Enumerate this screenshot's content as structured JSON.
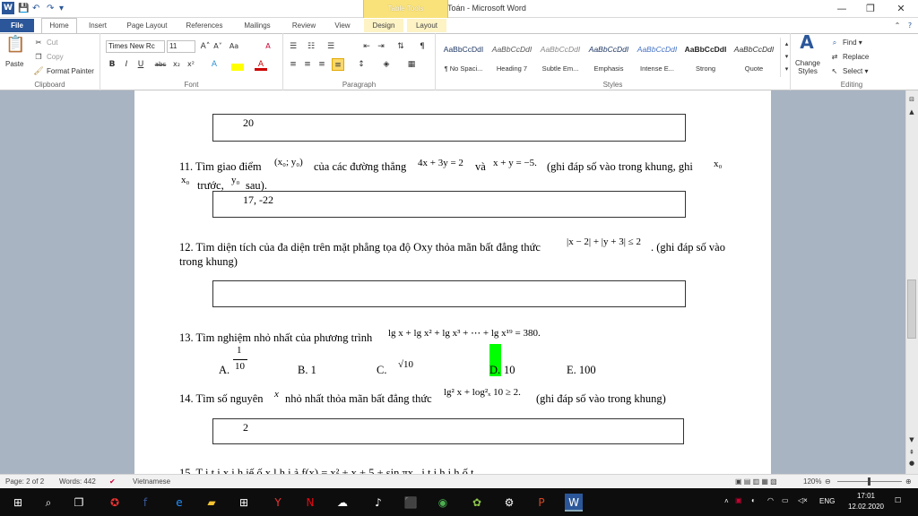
{
  "window": {
    "title": "Đề thi thứ môn Toán - Microsoft Word",
    "context_tab_group": "Table Tools"
  },
  "quick_access": {
    "word": "W",
    "save": "💾",
    "undo": "↶",
    "redo": "↷",
    "more": "▾"
  },
  "window_controls": {
    "minimize": "—",
    "restore": "❐",
    "close": "✕"
  },
  "tabs": [
    "File",
    "Home",
    "Insert",
    "Page Layout",
    "References",
    "Mailings",
    "Review",
    "View",
    "Design",
    "Layout"
  ],
  "clipboard": {
    "paste": "Paste",
    "cut": "Cut",
    "copy": "Copy",
    "format_painter": "Format Painter",
    "label": "Clipboard"
  },
  "font": {
    "name": "Times New Rc",
    "size": "11",
    "label": "Font",
    "bold": "B",
    "italic": "I",
    "underline": "U",
    "strike": "abc",
    "sub": "x₂",
    "sup": "x²",
    "grow": "A˄",
    "shrink": "A˅",
    "case": "Aa",
    "clear": "A"
  },
  "paragraph": {
    "label": "Paragraph"
  },
  "styles": {
    "label": "Styles",
    "items": [
      {
        "sample": "AaBbCcDdI",
        "name": "¶ No Spaci..."
      },
      {
        "sample": "AaBbCcDdI",
        "name": "Heading 7"
      },
      {
        "sample": "AaBbCcDdI",
        "name": "Subtle Em..."
      },
      {
        "sample": "AaBbCcDdI",
        "name": "Emphasis"
      },
      {
        "sample": "AaBbCcDdI",
        "name": "Intense E..."
      },
      {
        "sample": "AaBbCcDdI",
        "name": "Strong"
      },
      {
        "sample": "AaBbCcDdI",
        "name": "Quote"
      }
    ],
    "change": "Change Styles"
  },
  "editing": {
    "find": "Find ▾",
    "replace": "Replace",
    "select": "Select ▾",
    "label": "Editing"
  },
  "document": {
    "box1": "20",
    "q11_line1": "11. Tìm giao điểm",
    "q11_pt": "(x₀; y₀)",
    "q11_mid": "của các đường thẳng",
    "q11_eq1": "4x + 3y = 2",
    "q11_and": "và",
    "q11_eq2": "x + y = −5.",
    "q11_tail": "(ghi đáp số vào trong khung,  ghi",
    "q11_x0": "x₀",
    "q11_x0b": "x₀",
    "q11_line2a": "trước,",
    "q11_y0": "y₀",
    "q11_line2b": "sau).",
    "box2": "17, -22",
    "q12_line1": "12. Tìm diện tích của đa diện trên mặt phẳng tọa độ Oxy  thỏa mãn bất đẳng thức",
    "q12_ineq": "|x − 2| + |y + 3| ≤ 2",
    "q12_tail": ". (ghi đáp số vào",
    "q12_line2": "trong khung)",
    "box3": "",
    "q13": "13. Tìm nghiệm nhỏ nhất của phương trình",
    "q13_eq": "lg x + lg x² + lg x³ + ⋯ + lg x¹⁹ = 380.",
    "q13_a_label": "A.",
    "q13_a_num": "1",
    "q13_a_den": "10",
    "q13_b": "B.  1",
    "q13_c": "C.",
    "q13_c_val": "√10",
    "q13_d": "D.",
    "q13_d_val": "10",
    "q13_e": "E.  100",
    "q14": "14. Tìm số nguyên",
    "q14_x": "x",
    "q14_mid": "nhỏ nhất thỏa mãn bất đẳng thức",
    "q14_ineq": "lg² x + log²ₓ 10 ≥ 2.",
    "q14_tail": "(ghi đáp số vào trong khung)",
    "box4": "2",
    "q15_partial": "15. T         i   t  i x    i  h  iế      ố  x         l  h  i        ả    f(x) = x² + x + 5 + sin πx    ,    i  t  i  h  i  h  ố  t"
  },
  "status": {
    "page": "Page: 2 of 2",
    "words": "Words: 442",
    "language": "Vietnamese",
    "zoom": "120%"
  },
  "taskbar": {
    "lang": "ENG",
    "time": "17:01",
    "date": "12.02.2020"
  },
  "colors": {
    "accent": "#2b579a",
    "highlight": "#00ff00",
    "table_tools": "#f9e27a"
  }
}
